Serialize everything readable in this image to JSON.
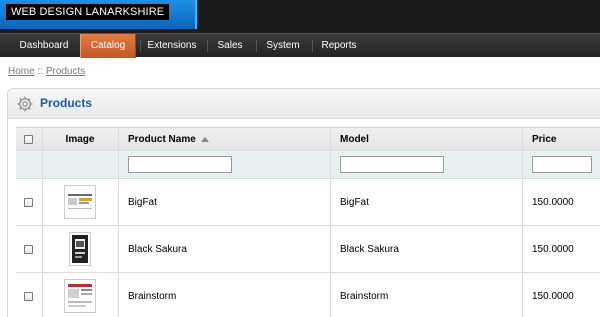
{
  "header": {
    "brand": "WEB DESIGN LANARKSHIRE"
  },
  "menu": {
    "items": [
      "Dashboard",
      "Catalog",
      "Extensions",
      "Sales",
      "System",
      "Reports"
    ],
    "active": "Catalog"
  },
  "breadcrumb": {
    "home": "Home",
    "separator": "::",
    "current": "Products"
  },
  "panel": {
    "title": "Products",
    "icon": "gear-icon"
  },
  "table": {
    "columns": {
      "image": "Image",
      "name": "Product Name",
      "model": "Model",
      "price": "Price"
    },
    "sorted_by": "Product Name",
    "sort_direction": "ascending",
    "filters": {
      "name": "",
      "model": "",
      "price": ""
    },
    "rows": [
      {
        "name": "BigFat",
        "model": "BigFat",
        "price": "150.0000",
        "selected": false
      },
      {
        "name": "Black Sakura",
        "model": "Black Sakura",
        "price": "150.0000",
        "selected": false
      },
      {
        "name": "Brainstorm",
        "model": "Brainstorm",
        "price": "150.0000",
        "selected": false
      }
    ]
  },
  "colors": {
    "accent_menu": "#d0622c",
    "title_blue": "#1b57b1",
    "filter_row": "#e7f1f1"
  }
}
